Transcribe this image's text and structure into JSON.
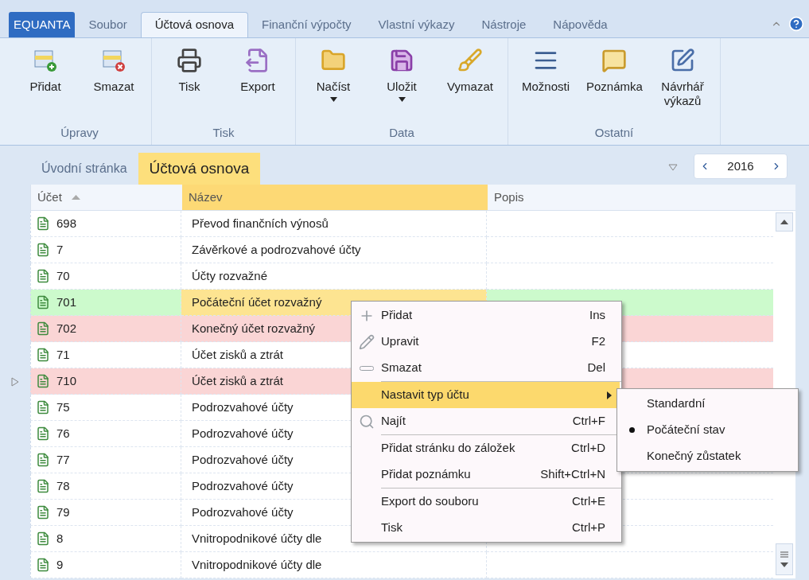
{
  "menu_tabs": [
    {
      "label": "EQUANTA",
      "kind": "app",
      "selected": false
    },
    {
      "label": "Soubor",
      "kind": "tab",
      "selected": false
    },
    {
      "label": "Účtová osnova",
      "kind": "tab",
      "selected": true
    },
    {
      "label": "Finanční výpočty",
      "kind": "tab",
      "selected": false
    },
    {
      "label": "Vlastní výkazy",
      "kind": "tab",
      "selected": false
    },
    {
      "label": "Nástroje",
      "kind": "tab",
      "selected": false
    },
    {
      "label": "Nápověda",
      "kind": "tab",
      "selected": false
    }
  ],
  "ribbon": [
    {
      "label": "Úpravy",
      "buttons": [
        {
          "label": "Přidat",
          "dropdown": false
        },
        {
          "label": "Smazat",
          "dropdown": false
        }
      ]
    },
    {
      "label": "Tisk",
      "buttons": [
        {
          "label": "Tisk",
          "dropdown": false
        },
        {
          "label": "Export",
          "dropdown": false
        }
      ]
    },
    {
      "label": "Data",
      "buttons": [
        {
          "label": "Načíst",
          "dropdown": true
        },
        {
          "label": "Uložit",
          "dropdown": true
        },
        {
          "label": "Vymazat",
          "dropdown": false
        }
      ]
    },
    {
      "label": "Ostatní",
      "buttons": [
        {
          "label": "Možnosti",
          "dropdown": false
        },
        {
          "label": "Poznámka",
          "dropdown": false
        },
        {
          "label": "Návrhář výkazů",
          "dropdown": false
        }
      ]
    }
  ],
  "doc_tabs": [
    {
      "label": "Úvodní stránka",
      "selected": false
    },
    {
      "label": "Účtová osnova",
      "selected": true
    }
  ],
  "year": "2016",
  "table": {
    "columns": [
      {
        "label": "Účet",
        "sorted": true,
        "selected": false
      },
      {
        "label": "Název",
        "sorted": false,
        "selected": true
      },
      {
        "label": "Popis",
        "sorted": false,
        "selected": false
      }
    ],
    "rows": [
      {
        "account": "698",
        "name": "Převod finančních výnosů",
        "color": "#ffffff",
        "selected": false,
        "current": false
      },
      {
        "account": "7",
        "name": "Závěrkové a podrozvahové účty",
        "color": "#ffffff",
        "selected": false,
        "current": false
      },
      {
        "account": "70",
        "name": "Účty rozvažné",
        "color": "#ffffff",
        "selected": false,
        "current": false
      },
      {
        "account": "701",
        "name": "Počáteční účet rozvažný",
        "color": "#ccfacc",
        "selected": true,
        "current": false
      },
      {
        "account": "702",
        "name": "Konečný účet rozvažný",
        "color": "#fad5d5",
        "selected": false,
        "current": false
      },
      {
        "account": "71",
        "name": "Účet zisků a ztrát",
        "color": "#ffffff",
        "selected": false,
        "current": false
      },
      {
        "account": "710",
        "name": "Účet zisků a ztrát",
        "color": "#fad5d5",
        "selected": false,
        "current": true
      },
      {
        "account": "75",
        "name": "Podrozvahové účty",
        "color": "#ffffff",
        "selected": false,
        "current": false
      },
      {
        "account": "76",
        "name": "Podrozvahové účty",
        "color": "#ffffff",
        "selected": false,
        "current": false
      },
      {
        "account": "77",
        "name": "Podrozvahové účty",
        "color": "#ffffff",
        "selected": false,
        "current": false
      },
      {
        "account": "78",
        "name": "Podrozvahové účty",
        "color": "#ffffff",
        "selected": false,
        "current": false
      },
      {
        "account": "79",
        "name": "Podrozvahové účty",
        "color": "#ffffff",
        "selected": false,
        "current": false
      },
      {
        "account": "8",
        "name": "Vnitropodnikové účty dle",
        "color": "#ffffff",
        "selected": false,
        "current": false
      },
      {
        "account": "9",
        "name": "Vnitropodnikové účty dle",
        "color": "#ffffff",
        "selected": false,
        "current": false
      }
    ]
  },
  "context_menu": {
    "groups": [
      [
        {
          "label": "Přidat",
          "shortcut": "Ins",
          "selected": false,
          "submenu": false
        },
        {
          "label": "Upravit",
          "shortcut": "F2",
          "selected": false,
          "submenu": false
        },
        {
          "label": "Smazat",
          "shortcut": "Del",
          "selected": false,
          "submenu": false
        }
      ],
      [
        {
          "label": "Nastavit typ účtu",
          "selected": true,
          "submenu": true
        },
        {
          "label": "Najít",
          "shortcut": "Ctrl+F",
          "selected": false,
          "submenu": false
        }
      ],
      [
        {
          "label": "Přidat stránku do záložek",
          "shortcut": "Ctrl+D",
          "selected": false,
          "submenu": false
        },
        {
          "label": "Přidat poznámku",
          "shortcut": "Shift+Ctrl+N",
          "selected": false,
          "submenu": false
        }
      ],
      [
        {
          "label": "Export do souboru",
          "shortcut": "Ctrl+E",
          "selected": false,
          "submenu": false
        },
        {
          "label": "Tisk",
          "shortcut": "Ctrl+P",
          "selected": false,
          "submenu": false
        }
      ]
    ],
    "submenu": [
      {
        "label": "Standardní",
        "selected": false
      },
      {
        "label": "Počáteční stav",
        "selected": true
      },
      {
        "label": "Konečný zůstatek",
        "selected": false
      }
    ]
  }
}
